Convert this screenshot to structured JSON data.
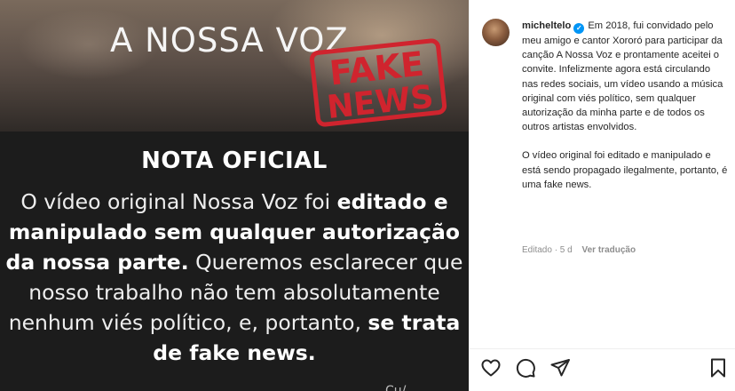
{
  "post_image": {
    "song_title": "A NOSSA VOZ",
    "stamp_line1": "FAKE",
    "stamp_line2": "NEWS",
    "note_title": "NOTA OFICIAL",
    "note_body": {
      "p1": "O vídeo original Nossa Voz foi ",
      "b1": "editado e manipulado sem qualquer autorização da nossa parte.",
      "p2": " Queremos esclarecer que nosso trabalho não tem absolutamente nenhum viés político, e, portanto, ",
      "b2": "se trata de fake news."
    },
    "corner_mark": "Cu/..."
  },
  "caption": {
    "username": "micheltelo",
    "paragraph1": "Em 2018, fui convidado pelo meu amigo e cantor Xororó para participar da canção A Nossa Voz e prontamente aceitei o convite. Infelizmente agora está circulando nas redes sociais, um vídeo usando a música original com viés político, sem qualquer autorização da minha parte e de todos os outros artistas envolvidos.",
    "paragraph2": "O vídeo original foi editado e manipulado e está sendo propagado ilegalmente, portanto, é uma fake news.",
    "meta_edited": "Editado · 5 d",
    "meta_translate": "Ver tradução"
  },
  "actions": {
    "like_icon": "heart-icon",
    "comment_icon": "comment-icon",
    "share_icon": "share-icon",
    "save_icon": "bookmark-icon"
  },
  "colors": {
    "verified_blue": "#0095f6",
    "stamp_red": "#d0242e",
    "note_background": "#1c1c1c"
  }
}
